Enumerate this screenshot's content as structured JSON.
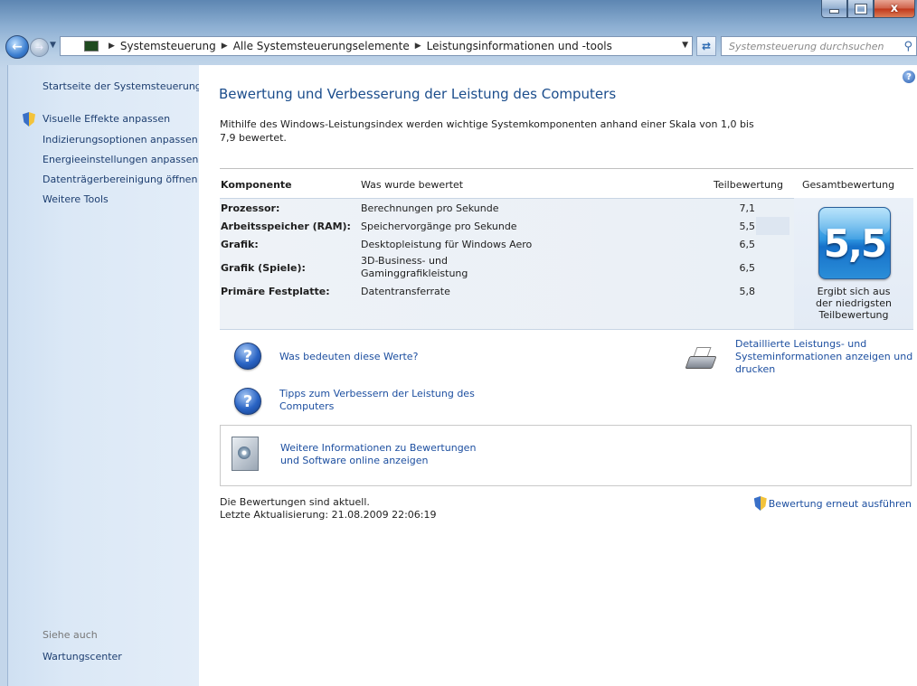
{
  "window": {
    "minimize_label": "",
    "maximize_label": "",
    "close_label": "x"
  },
  "navigation": {
    "breadcrumbs": [
      "Systemsteuerung",
      "Alle Systemsteuerungselemente",
      "Leistungsinformationen und -tools"
    ],
    "search_placeholder": "Systemsteuerung durchsuchen"
  },
  "sidebar": {
    "home_link": "Startseite der Systemsteuerung",
    "tasks": [
      {
        "label": "Visuelle Effekte anpassen",
        "icon": "uac-shield-icon"
      },
      {
        "label": "Indizierungsoptionen anpassen"
      },
      {
        "label": "Energieeinstellungen anpassen"
      },
      {
        "label": "Datenträgerbereinigung öffnen"
      },
      {
        "label": "Weitere Tools"
      }
    ],
    "see_also_heading": "Siehe auch",
    "see_also_links": [
      "Wartungscenter"
    ]
  },
  "main": {
    "title": "Bewertung und Verbesserung der Leistung des Computers",
    "intro_line1": "Mithilfe des Windows-Leistungsindex werden wichtige Systemkomponenten anhand einer Skala von 1,0 bis",
    "intro_line2": "7,9 bewertet.",
    "table": {
      "headers": {
        "component": "Komponente",
        "rated": "Was wurde bewertet",
        "subscore": "Teilbewertung",
        "basescore": "Gesamtbewertung"
      },
      "rows": [
        {
          "component": "Prozessor:",
          "rated": "Berechnungen pro Sekunde",
          "score": "7,1"
        },
        {
          "component": "Arbeitsspeicher (RAM):",
          "rated": "Speichervorgänge pro Sekunde",
          "score": "5,5"
        },
        {
          "component": "Grafik:",
          "rated": "Desktopleistung für Windows Aero",
          "score": "6,5"
        },
        {
          "component": "Grafik (Spiele):",
          "rated_line1": "3D-Business- und",
          "rated_line2": "Gaminggrafikleistung",
          "score": "6,5"
        },
        {
          "component": "Primäre Festplatte:",
          "rated": "Datentransferrate",
          "score": "5,8"
        }
      ],
      "base_score": "5,5",
      "base_caption_line1": "Ergibt sich aus",
      "base_caption_line2": "der niedrigsten",
      "base_caption_line3": "Teilbewertung"
    },
    "links": {
      "what_mean": "Was bedeuten diese Werte?",
      "tips_line1": "Tipps zum Verbessern der Leistung des",
      "tips_line2": "Computers",
      "detailed_line1": "Detaillierte Leistungs- und",
      "detailed_line2": "Systeminformationen anzeigen und",
      "detailed_line3": "drucken",
      "online_line1": "Weitere Informationen zu Bewertungen",
      "online_line2": "und Software online anzeigen"
    },
    "status_line1": "Die Bewertungen sind aktuell.",
    "status_line2": "Letzte Aktualisierung: 21.08.2009 22:06:19",
    "rerun_label": "Bewertung erneut ausführen",
    "help_label": "?"
  },
  "colors": {
    "link": "#1d4fa0",
    "title": "#1b4d8c",
    "sidebar_bg": "#dbe8f6",
    "score_tile": "#2d96e0"
  }
}
